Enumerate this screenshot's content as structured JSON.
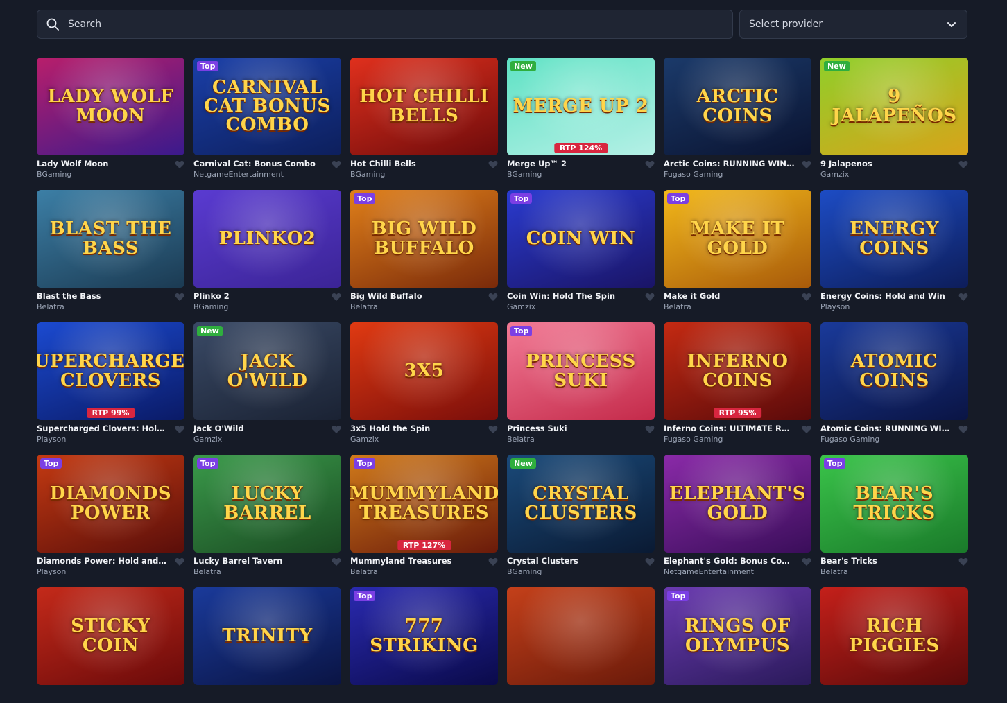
{
  "search": {
    "placeholder": "Search"
  },
  "provider_select": {
    "label": "Select provider"
  },
  "games": [
    {
      "title": "Lady Wolf Moon",
      "provider": "BGaming",
      "badge": "",
      "rtp": "",
      "logo": "Lady Wolf Moon",
      "bg1": "#b81e6b",
      "bg2": "#3a1a8c"
    },
    {
      "title": "Carnival Cat: Bonus Combo",
      "provider": "NetgameEntertainment",
      "badge": "Top",
      "rtp": "",
      "logo": "Carnival Cat Bonus Combo",
      "bg1": "#1a3fa8",
      "bg2": "#0d1f5c"
    },
    {
      "title": "Hot Chilli Bells",
      "provider": "BGaming",
      "badge": "",
      "rtp": "",
      "logo": "Hot Chilli Bells",
      "bg1": "#e0301d",
      "bg2": "#6e0b0b"
    },
    {
      "title": "Merge Up™ 2",
      "provider": "BGaming",
      "badge": "New",
      "rtp": "RTP 124%",
      "logo": "Merge Up 2",
      "bg1": "#5ee2c4",
      "bg2": "#b5f0e6"
    },
    {
      "title": "Arctic Coins: RUNNING WINS™",
      "provider": "Fugaso Gaming",
      "badge": "",
      "rtp": "",
      "logo": "Arctic Coins",
      "bg1": "#1b3a6a",
      "bg2": "#0a1330"
    },
    {
      "title": "9 Jalapenos",
      "provider": "Gamzix",
      "badge": "New",
      "rtp": "",
      "logo": "9 Jalapeños",
      "bg1": "#8fcf2a",
      "bg2": "#d8a31a"
    },
    {
      "title": "Blast the Bass",
      "provider": "Belatra",
      "badge": "",
      "rtp": "",
      "logo": "Blast the Bass",
      "bg1": "#3c7fa6",
      "bg2": "#1b3a52"
    },
    {
      "title": "Plinko 2",
      "provider": "BGaming",
      "badge": "",
      "rtp": "",
      "logo": "Plinko2",
      "bg1": "#5a3bd1",
      "bg2": "#3b2496"
    },
    {
      "title": "Big Wild Buffalo",
      "provider": "Belatra",
      "badge": "Top",
      "rtp": "",
      "logo": "Big Wild Buffalo",
      "bg1": "#e0801a",
      "bg2": "#7a2a0a"
    },
    {
      "title": "Coin Win: Hold The Spin",
      "provider": "Gamzix",
      "badge": "Top",
      "rtp": "",
      "logo": "Coin Win",
      "bg1": "#2a3bd0",
      "bg2": "#1a1466"
    },
    {
      "title": "Make it Gold",
      "provider": "Belatra",
      "badge": "Top",
      "rtp": "",
      "logo": "Make it Gold",
      "bg1": "#f2b81a",
      "bg2": "#a85a0a"
    },
    {
      "title": "Energy Coins: Hold and Win",
      "provider": "Playson",
      "badge": "",
      "rtp": "",
      "logo": "Energy Coins",
      "bg1": "#1d4cc4",
      "bg2": "#0d1d5a"
    },
    {
      "title": "Supercharged Clovers: Hold and Win",
      "provider": "Playson",
      "badge": "",
      "rtp": "RTP 99%",
      "logo": "Supercharged Clovers",
      "bg1": "#1b4ad0",
      "bg2": "#0a1a66"
    },
    {
      "title": "Jack O'Wild",
      "provider": "Gamzix",
      "badge": "New",
      "rtp": "",
      "logo": "Jack O'Wild",
      "bg1": "#3a4a66",
      "bg2": "#1a2233"
    },
    {
      "title": "3x5 Hold the Spin",
      "provider": "Gamzix",
      "badge": "",
      "rtp": "",
      "logo": "3x5",
      "bg1": "#e03a12",
      "bg2": "#7a0e0a"
    },
    {
      "title": "Princess Suki",
      "provider": "Belatra",
      "badge": "Top",
      "rtp": "",
      "logo": "Princess Suki",
      "bg1": "#f27a95",
      "bg2": "#c42a4a"
    },
    {
      "title": "Inferno Coins: ULTIMATE RUNNING WINS",
      "provider": "Fugaso Gaming",
      "badge": "",
      "rtp": "RTP 95%",
      "logo": "Inferno Coins",
      "bg1": "#c42a12",
      "bg2": "#5a0a0a"
    },
    {
      "title": "Atomic Coins: RUNNING WINS™",
      "provider": "Fugaso Gaming",
      "badge": "",
      "rtp": "",
      "logo": "Atomic Coins",
      "bg1": "#1a3a9a",
      "bg2": "#0a1444"
    },
    {
      "title": "Diamonds Power: Hold and Win",
      "provider": "Playson",
      "badge": "Top",
      "rtp": "",
      "logo": "Diamonds Power",
      "bg1": "#c43a12",
      "bg2": "#5a0e0a"
    },
    {
      "title": "Lucky Barrel Tavern",
      "provider": "Belatra",
      "badge": "Top",
      "rtp": "",
      "logo": "Lucky Barrel",
      "bg1": "#3a9a4a",
      "bg2": "#1a4a22"
    },
    {
      "title": "Mummyland Treasures",
      "provider": "Belatra",
      "badge": "Top",
      "rtp": "RTP 127%",
      "logo": "Mummyland Treasures",
      "bg1": "#d07a1a",
      "bg2": "#6a1a0a"
    },
    {
      "title": "Crystal Clusters",
      "provider": "BGaming",
      "badge": "New",
      "rtp": "",
      "logo": "Crystal Clusters",
      "bg1": "#1a4a7a",
      "bg2": "#0a1a33"
    },
    {
      "title": "Elephant's Gold: Bonus Combo",
      "provider": "NetgameEntertainment",
      "badge": "",
      "rtp": "",
      "logo": "Elephant's Gold",
      "bg1": "#8a2aa8",
      "bg2": "#3a0e5a"
    },
    {
      "title": "Bear's Tricks",
      "provider": "Belatra",
      "badge": "Top",
      "rtp": "",
      "logo": "Bear's Tricks",
      "bg1": "#3ac44a",
      "bg2": "#1a7a2a"
    },
    {
      "title": "",
      "provider": "",
      "badge": "",
      "rtp": "",
      "logo": "Sticky Coin",
      "bg1": "#c42a1a",
      "bg2": "#6a0a0a"
    },
    {
      "title": "",
      "provider": "",
      "badge": "",
      "rtp": "",
      "logo": "Trinity",
      "bg1": "#1a3a9a",
      "bg2": "#0a1444"
    },
    {
      "title": "",
      "provider": "",
      "badge": "Top",
      "rtp": "",
      "logo": "777 Striking",
      "bg1": "#2a2ab0",
      "bg2": "#0a0a4a"
    },
    {
      "title": "",
      "provider": "",
      "badge": "",
      "rtp": "",
      "logo": "",
      "bg1": "#c4401a",
      "bg2": "#6a1a0a"
    },
    {
      "title": "",
      "provider": "",
      "badge": "Top",
      "rtp": "",
      "logo": "Rings of Olympus",
      "bg1": "#6a3ab0",
      "bg2": "#2a1a5a"
    },
    {
      "title": "",
      "provider": "",
      "badge": "",
      "rtp": "",
      "logo": "Rich Piggies",
      "bg1": "#c4201a",
      "bg2": "#5a0a0a"
    }
  ]
}
